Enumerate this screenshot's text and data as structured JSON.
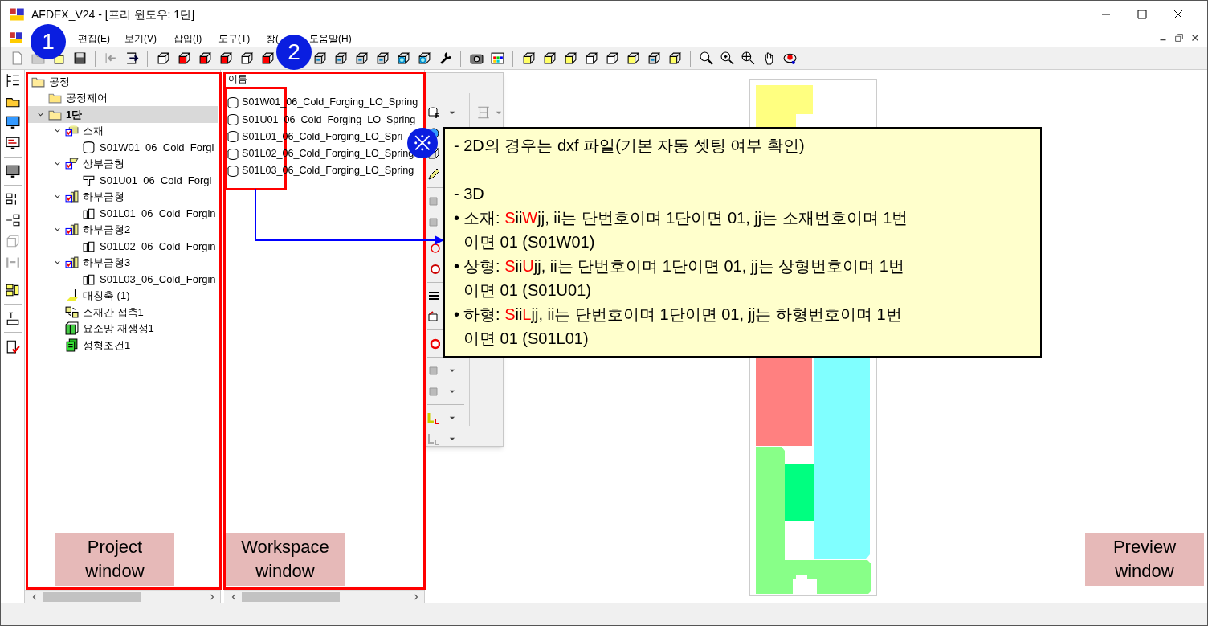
{
  "window": {
    "title": "AFDEX_V24 - [프리 윈도우: 1단]"
  },
  "menu": [
    "편집(E)",
    "보기(V)",
    "삽입(I)",
    "도구(T)",
    "창(",
    "도움말(H)"
  ],
  "project_tree": [
    {
      "label": "공정",
      "kind": "folder_open",
      "selected": false,
      "children": [
        {
          "label": "공정제어",
          "kind": "folder",
          "selected": false
        },
        {
          "label": "1단",
          "kind": "folder_open",
          "selected": true,
          "expanded": true,
          "children": [
            {
              "label": "소재",
              "kind": "material",
              "selected": false,
              "expanded": true,
              "children": [
                {
                  "label": "S01W01_06_Cold_Forgi",
                  "kind": "billet",
                  "selected": false
                }
              ]
            },
            {
              "label": "상부금형",
              "kind": "upper_die",
              "selected": false,
              "expanded": true,
              "children": [
                {
                  "label": "S01U01_06_Cold_Forgi",
                  "kind": "punch",
                  "selected": false
                }
              ]
            },
            {
              "label": "하부금형",
              "kind": "lower_die",
              "selected": false,
              "expanded": true,
              "children": [
                {
                  "label": "S01L01_06_Cold_Forgin",
                  "kind": "die",
                  "selected": false
                }
              ]
            },
            {
              "label": "하부금형2",
              "kind": "lower_die",
              "selected": false,
              "expanded": true,
              "children": [
                {
                  "label": "S01L02_06_Cold_Forgin",
                  "kind": "die",
                  "selected": false
                }
              ]
            },
            {
              "label": "하부금형3",
              "kind": "lower_die",
              "selected": false,
              "expanded": true,
              "children": [
                {
                  "label": "S01L03_06_Cold_Forgin",
                  "kind": "die",
                  "selected": false
                }
              ]
            },
            {
              "label": "대칭축 (1)",
              "kind": "axis",
              "selected": false
            },
            {
              "label": "소재간 접촉1",
              "kind": "contact",
              "selected": false
            },
            {
              "label": "요소망 재생성1",
              "kind": "mesh",
              "selected": false
            },
            {
              "label": "성형조건1",
              "kind": "condition",
              "selected": false
            }
          ]
        }
      ]
    }
  ],
  "workspace": {
    "column_header": "이름",
    "items": [
      "S01W01_06_Cold_Forging_LO_Spring",
      "S01U01_06_Cold_Forging_LO_Spring",
      "S01L01_06_Cold_Forging_LO_Spri",
      "S01L02_06_Cold_Forging_LO_Spring",
      "S01L03_06_Cold_Forging_LO_Spring"
    ]
  },
  "callout": {
    "marker": "※",
    "lines": [
      {
        "kind": "dash",
        "text": "- 2D의 경우는 dxf 파일(기본 자동 셋팅 여부 확인)"
      },
      {
        "kind": "dash",
        "text": "- 3D"
      },
      {
        "kind": "bullet",
        "marker": "•",
        "label": "소재: ",
        "code": [
          {
            "text": "S",
            "highlight": true
          },
          {
            "text": "ii",
            "highlight": false
          },
          {
            "text": "W",
            "highlight": true
          },
          {
            "text": "jj",
            "highlight": false
          }
        ],
        "lines": [
          ", ii는 단번호이며 1단이면 01, jj는 소재번호이며 1번",
          "이면 01 (S01W01)"
        ]
      },
      {
        "kind": "bullet",
        "marker": "•",
        "label": "상형: ",
        "code": [
          {
            "text": "S",
            "highlight": true
          },
          {
            "text": "ii",
            "highlight": false
          },
          {
            "text": "U",
            "highlight": true
          },
          {
            "text": "jj",
            "highlight": false
          }
        ],
        "lines": [
          ", ii는 단번호이며 1단이면 01, jj는 상형번호이며 1번",
          "이면 01 (S01U01)"
        ]
      },
      {
        "kind": "bullet",
        "marker": "•",
        "label": "하형: ",
        "code": [
          {
            "text": "S",
            "highlight": true
          },
          {
            "text": "ii",
            "highlight": false
          },
          {
            "text": "L",
            "highlight": true
          },
          {
            "text": "jj",
            "highlight": false
          }
        ],
        "lines": [
          ", ii는 단번호이며 1단이면 01, jj는 하형번호이며 1번",
          "이면 01 (S01L01)"
        ]
      }
    ]
  },
  "annotations": {
    "badges": [
      "1",
      "2"
    ],
    "labels": [
      "Project window",
      "Workspace window",
      "Preview window"
    ]
  }
}
